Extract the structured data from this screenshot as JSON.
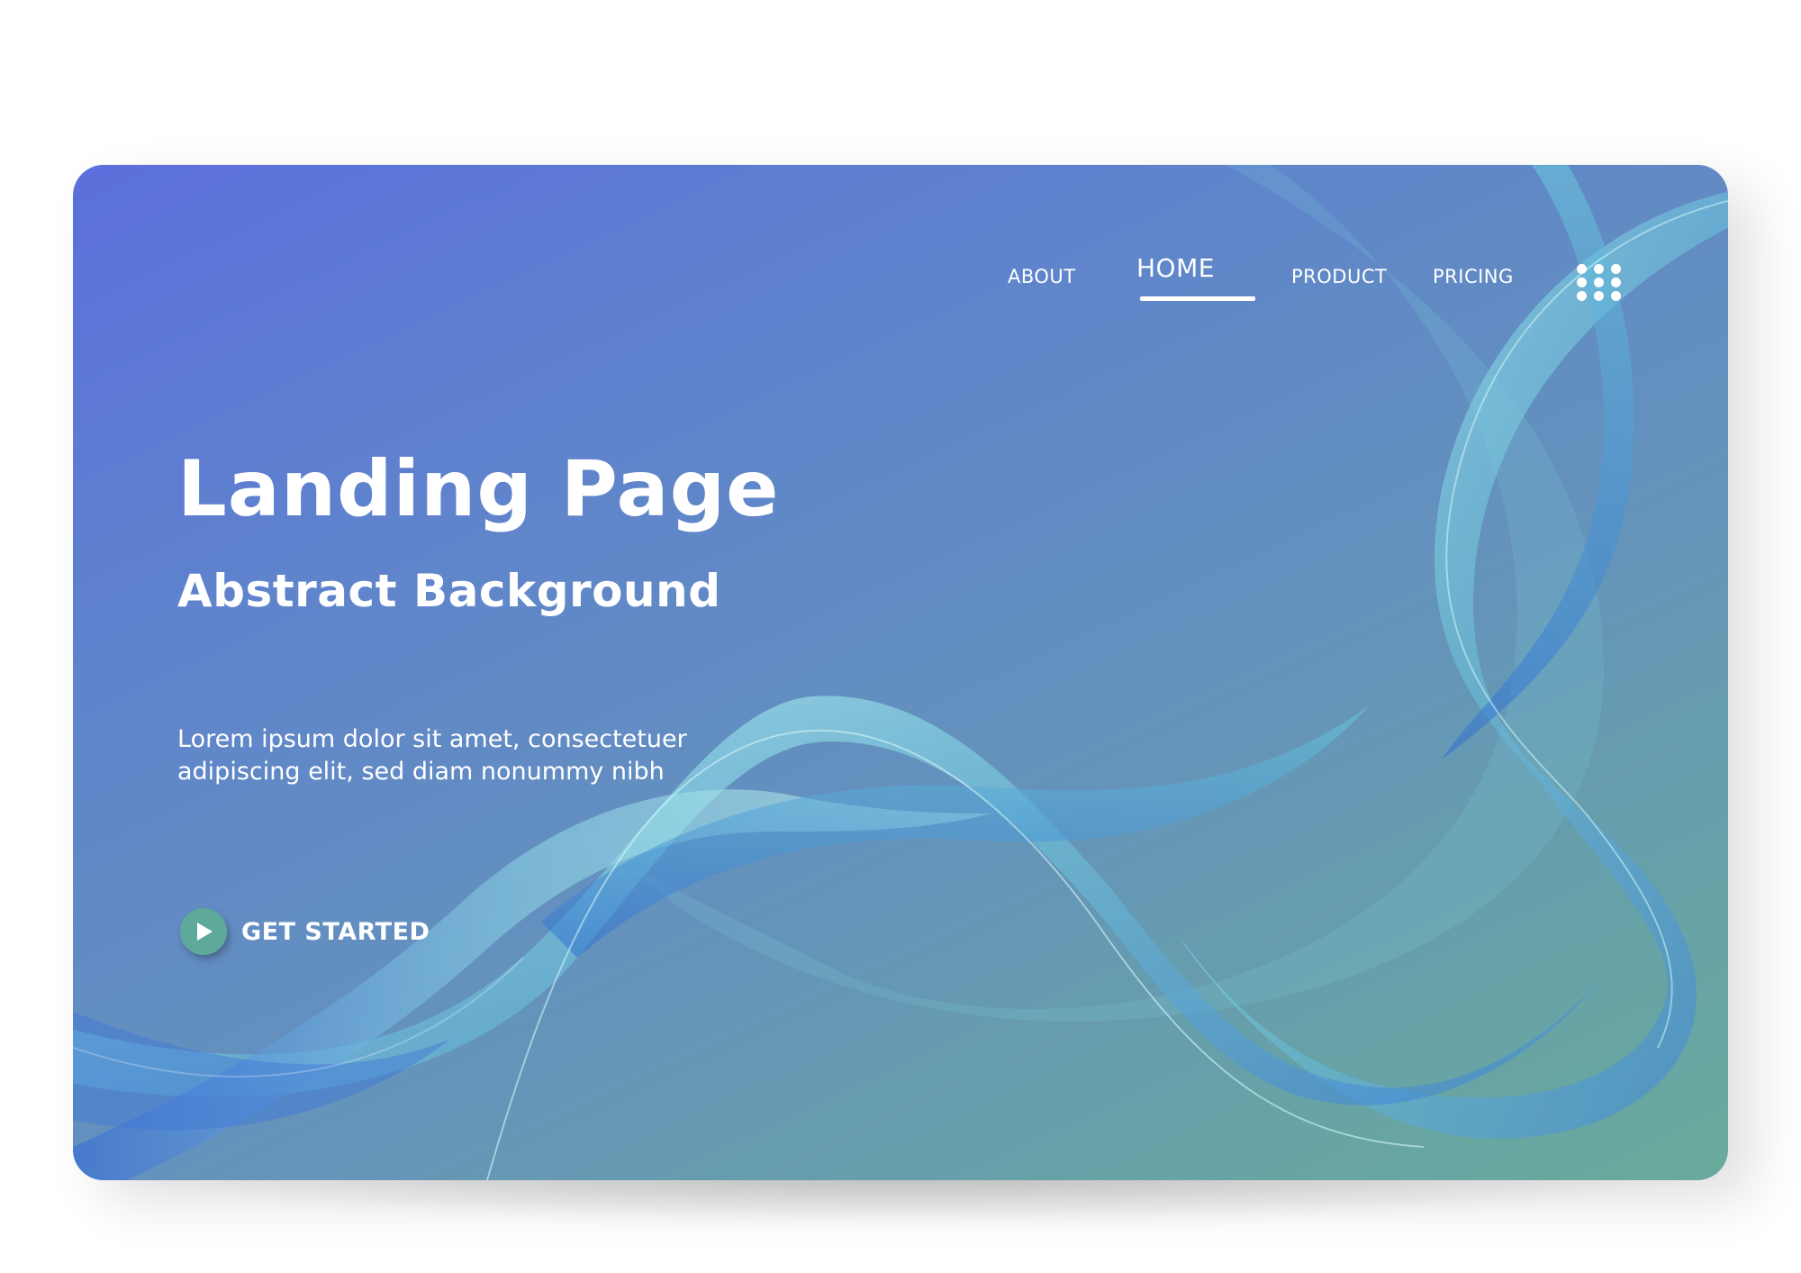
{
  "nav": {
    "items": [
      {
        "label": "ABOUT"
      },
      {
        "label": "HOME"
      },
      {
        "label": "PRODUCT"
      },
      {
        "label": "PRICING"
      }
    ],
    "active": "HOME",
    "menu_icon": "grid-dots-icon"
  },
  "hero": {
    "title": "Landing Page",
    "subtitle": "Abstract Background",
    "body_line1": "Lorem ipsum dolor sit amet, consectetuer",
    "body_line2": "adipiscing elit, sed diam nonummy nibh"
  },
  "cta": {
    "label": "GET STARTED",
    "icon": "play-icon"
  },
  "colors": {
    "gradient_start": "#5b6fdc",
    "gradient_end": "#69ab9c",
    "cta_circle": "#5fa99a",
    "text": "#ffffff"
  }
}
